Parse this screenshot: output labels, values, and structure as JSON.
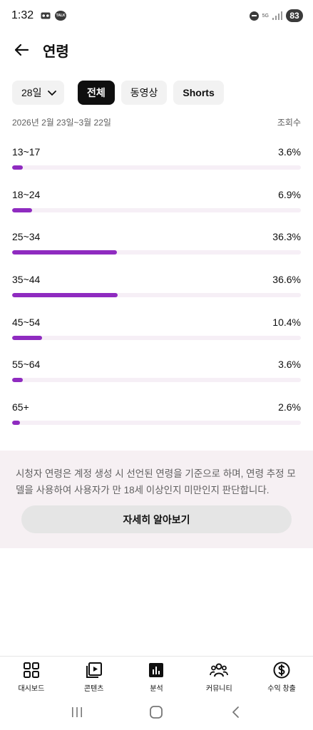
{
  "status_bar": {
    "time": "1:32",
    "talk_badge": "TALK",
    "network": "5G",
    "battery": "83"
  },
  "header": {
    "title": "연령"
  },
  "filters": {
    "period": "28일",
    "chips": [
      "전체",
      "동영상",
      "Shorts"
    ],
    "active_chip": "전체"
  },
  "date_range": "2026년 2월 23일~3월 22일",
  "metric_label": "조회수",
  "accent_color": "#8f2bc0",
  "age_groups": [
    {
      "label": "13~17",
      "value": "3.6%",
      "percent": 3.6
    },
    {
      "label": "18~24",
      "value": "6.9%",
      "percent": 6.9
    },
    {
      "label": "25~34",
      "value": "36.3%",
      "percent": 36.3
    },
    {
      "label": "35~44",
      "value": "36.6%",
      "percent": 36.6
    },
    {
      "label": "45~54",
      "value": "10.4%",
      "percent": 10.4
    },
    {
      "label": "55~64",
      "value": "3.6%",
      "percent": 3.6
    },
    {
      "label": "65+",
      "value": "2.6%",
      "percent": 2.6
    }
  ],
  "info": {
    "text": "시청자 연령은 계정 생성 시 선언된 연령을 기준으로 하며, 연령 추정 모델을 사용하여 사용자가 만 18세 이상인지 미만인지 판단합니다.",
    "button": "자세히 알아보기"
  },
  "bottom_nav": [
    {
      "label": "대시보드",
      "icon": "dashboard-icon"
    },
    {
      "label": "콘텐츠",
      "icon": "content-icon"
    },
    {
      "label": "분석",
      "icon": "analytics-icon",
      "active": true
    },
    {
      "label": "커뮤니티",
      "icon": "community-icon"
    },
    {
      "label": "수익 창출",
      "icon": "dollar-icon"
    }
  ]
}
